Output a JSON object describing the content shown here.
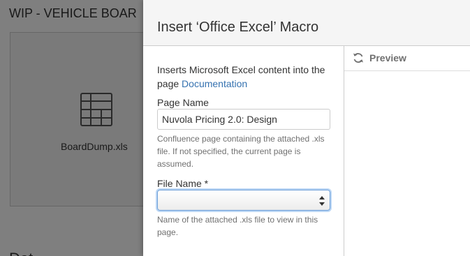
{
  "background": {
    "page_title": "WIP - VEHICLE BOAR",
    "attachment_name": "BoardDump.xls",
    "section_heading": "Dat"
  },
  "dialog": {
    "title": "Insert ‘Office Excel’ Macro",
    "description": "Inserts Microsoft Excel content into the page",
    "documentation_link": "Documentation",
    "page_name": {
      "label": "Page Name",
      "value": "Nuvola Pricing 2.0: Design",
      "help": "Confluence page containing the attached .xls file. If not specified, the current page is assumed."
    },
    "file_name": {
      "label": "File Name *",
      "selected": "",
      "help": "Name of the attached .xls file to view in this page."
    },
    "preview": {
      "label": "Preview",
      "icon": "refresh-icon"
    }
  },
  "colors": {
    "link": "#3572b0",
    "focus": "#6d9fd8",
    "overlay": "rgba(0,0,0,0.5)"
  }
}
